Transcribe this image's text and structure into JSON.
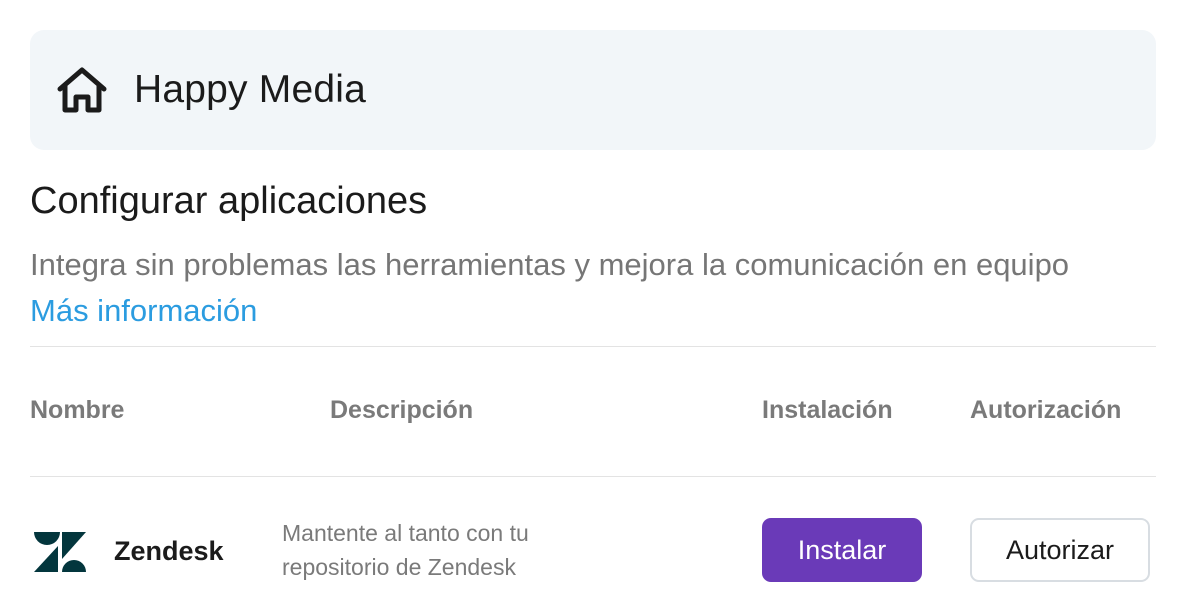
{
  "workspace": {
    "name": "Happy Media",
    "icon": "home-icon"
  },
  "page": {
    "title": "Configurar aplicaciones",
    "subtitle": "Integra sin problemas las herramientas y mejora la comunicación en equipo",
    "more_link": "Más información"
  },
  "table": {
    "headers": {
      "name": "Nombre",
      "description": "Descripción",
      "install": "Instalación",
      "auth": "Autorización"
    },
    "rows": [
      {
        "icon": "zendesk-logo",
        "name": "Zendesk",
        "description": "Mantente al tanto con tu repositorio de Zendesk",
        "install_label": "Instalar",
        "auth_label": "Autorizar"
      }
    ]
  },
  "colors": {
    "accent": "#6a3ab8",
    "link": "#2b9ce0",
    "card_bg": "#f2f6f9",
    "zendesk": "#03363d"
  }
}
